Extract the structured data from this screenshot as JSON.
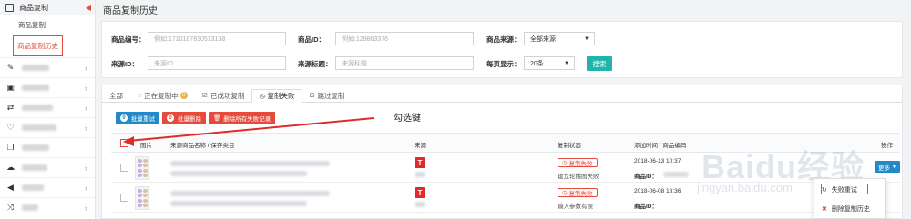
{
  "sidebar": {
    "section_label": "商品复制",
    "sub_items": [
      {
        "label": "商品复制"
      },
      {
        "label": "商品复制历史"
      }
    ],
    "items": [
      {
        "icon": "edit-icon",
        "label": "编辑"
      },
      {
        "icon": "image-icon",
        "label": ""
      },
      {
        "icon": "transfer-icon",
        "label": ""
      },
      {
        "icon": "heart-icon",
        "label": ""
      },
      {
        "icon": "copy-icon",
        "label": ""
      },
      {
        "icon": "cloud-icon",
        "label": ""
      },
      {
        "icon": "megaphone-icon",
        "label": ""
      },
      {
        "icon": "swap-icon",
        "label": ""
      }
    ]
  },
  "page": {
    "title": "商品复制历史"
  },
  "filters": {
    "product_code_label": "商品编号：",
    "product_code_placeholder": "例如:1710187830513138",
    "product_id_label": "商品ID：",
    "product_id_placeholder": "例如:129863376",
    "product_source_label": "商品来源：",
    "product_source_value": "全部来源",
    "source_id_label": "来源ID：",
    "source_id_placeholder": "来源ID",
    "source_title_label": "来源标题：",
    "source_title_placeholder": "来源标题",
    "per_page_label": "每页显示：",
    "per_page_value": "20条",
    "search_button": "搜索"
  },
  "tabs": [
    {
      "label": "全部",
      "icon": ""
    },
    {
      "label": "正在复制中",
      "icon": "spinner-icon",
      "badge": "0"
    },
    {
      "label": "已成功复制",
      "icon": "check-icon"
    },
    {
      "label": "复制失败",
      "icon": "clock-icon"
    },
    {
      "label": "跳过复制",
      "icon": "skip-icon"
    }
  ],
  "actions": {
    "batch_retry": {
      "count": "0",
      "label": "批量重试"
    },
    "batch_delete": {
      "count": "0",
      "label": "批量删除"
    },
    "delete_all_failed": "删除所有失败记录"
  },
  "annotation": "勾选键",
  "table": {
    "headers": {
      "image": "图片",
      "name": "来源商品名称 / 保存类目",
      "source": "来源",
      "status": "复制状态",
      "time": "添加时间 / 商品编码",
      "ops": "操作"
    },
    "rows": [
      {
        "source_badge": "T",
        "status": "复制失败",
        "status_detail": "建立轮播图失败",
        "time": "2018-06-13 10:37",
        "code_label": "商品ID：",
        "code_value": "",
        "more": "更多"
      },
      {
        "source_badge": "T",
        "status": "复制失败",
        "status_detail": "输入参数有误",
        "time": "2018-06-08 18:36",
        "code_label": "商品ID：",
        "code_value": "--",
        "more": ""
      }
    ]
  },
  "dropdown": {
    "items": [
      {
        "icon": "refresh-icon",
        "label": "失败重试"
      },
      {
        "icon": "close-icon",
        "label": "删除复制历史"
      }
    ]
  },
  "watermark": {
    "logo": "Baidu经验",
    "url": "jingyan.baidu.com"
  },
  "colors": {
    "accent_red": "#e64a3b",
    "accent_blue": "#2389c9",
    "teal": "#1fb5ad"
  }
}
